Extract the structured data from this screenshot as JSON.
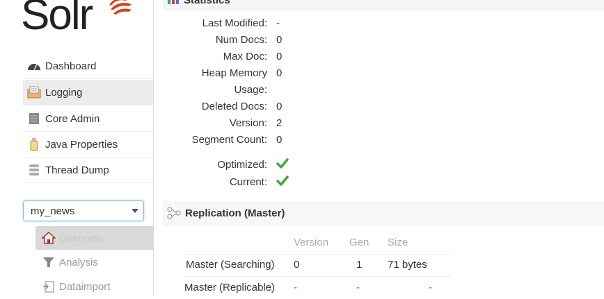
{
  "app": {
    "logo_text": "Solr"
  },
  "sidebar": {
    "items": [
      {
        "label": "Dashboard",
        "icon": "dashboard-icon",
        "active": false
      },
      {
        "label": "Logging",
        "icon": "logging-icon",
        "active": true
      },
      {
        "label": "Core Admin",
        "icon": "core-admin-icon",
        "active": false
      },
      {
        "label": "Java Properties",
        "icon": "java-properties-icon",
        "active": false
      },
      {
        "label": "Thread Dump",
        "icon": "thread-dump-icon",
        "active": false
      }
    ],
    "core_selector": {
      "value": "my_news"
    },
    "core_items": [
      {
        "label": "Overview",
        "icon": "home-icon",
        "active": true
      },
      {
        "label": "Analysis",
        "icon": "filter-icon",
        "active": false
      },
      {
        "label": "Dataimport",
        "icon": "dataimport-icon",
        "active": false
      }
    ]
  },
  "statistics": {
    "title": "Statistics",
    "rows": [
      {
        "key": "Last Modified:",
        "value": "-"
      },
      {
        "key": "Num Docs:",
        "value": "0"
      },
      {
        "key": "Max Doc:",
        "value": "0"
      },
      {
        "key": "Heap Memory",
        "value": "0"
      },
      {
        "key": "Usage:",
        "value": ""
      },
      {
        "key": "Deleted Docs:",
        "value": "0"
      },
      {
        "key": "Version:",
        "value": "2"
      },
      {
        "key": "Segment Count:",
        "value": "0"
      }
    ],
    "optimized_label": "Optimized:",
    "current_label": "Current:"
  },
  "replication": {
    "title": "Replication (Master)",
    "columns": [
      "Version",
      "Gen",
      "Size"
    ],
    "rows": [
      {
        "name": "Master (Searching)",
        "version": "0",
        "gen": "1",
        "size": "71 bytes"
      },
      {
        "name": "Master (Replicable)",
        "version": "-",
        "gen": "-",
        "size": "-"
      }
    ]
  },
  "colors": {
    "accent_red": "#d9411e",
    "check_green": "#3ea83a"
  }
}
